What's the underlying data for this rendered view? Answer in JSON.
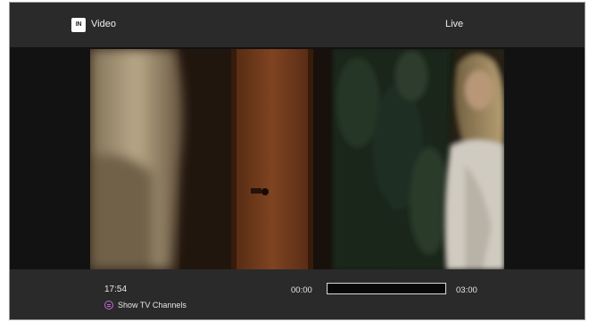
{
  "header": {
    "app_badge": "IN",
    "title": "Video",
    "status": "Live"
  },
  "player": {
    "clock": "17:54",
    "elapsed": "00:00",
    "duration": "03:00",
    "progress_fraction": 0,
    "channels_button_label": "Show TV Channels",
    "channels_icon": "list-circle-icon",
    "accent_color": "#c566d8"
  }
}
